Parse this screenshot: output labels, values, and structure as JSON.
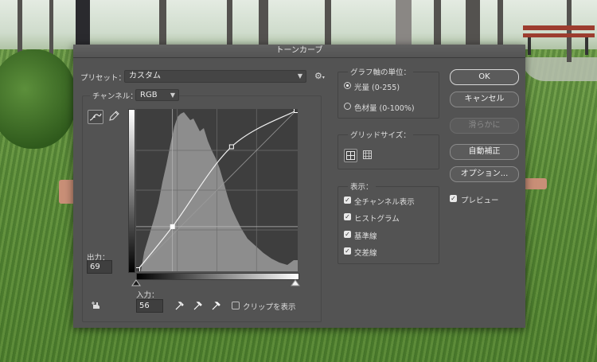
{
  "dialog": {
    "title": "トーンカーブ"
  },
  "preset": {
    "label": "プリセット：",
    "value": "カスタム",
    "menu_icon": "gear-icon"
  },
  "channel": {
    "label": "チャンネル：",
    "value": "RGB"
  },
  "tools": {
    "curve_tool_icon": "curve-point-icon",
    "pencil_tool_icon": "pencil-icon",
    "auto_adjust_icon": "hand-target-icon"
  },
  "curve": {
    "points": [
      {
        "input": 0,
        "output": 0
      },
      {
        "input": 56,
        "output": 69
      },
      {
        "input": 151,
        "output": 197
      },
      {
        "input": 255,
        "output": 255
      }
    ],
    "selected_point": 1
  },
  "output": {
    "label": "出力：",
    "value": "69"
  },
  "input": {
    "label": "入力：",
    "value": "56"
  },
  "eyedroppers": [
    "eyedropper-black-icon",
    "eyedropper-gray-icon",
    "eyedropper-white-icon"
  ],
  "show_clipping": {
    "label": "クリップを表示",
    "checked": false
  },
  "graph_units": {
    "title": "グラフ軸の単位：",
    "options": [
      {
        "label": "光量 (0-255)",
        "selected": true
      },
      {
        "label": "色材量 (0-100%)",
        "selected": false
      }
    ]
  },
  "grid_size": {
    "title": "グリッドサイズ：",
    "options": [
      "grid-4x4-icon",
      "grid-10x10-icon"
    ],
    "selected": 0
  },
  "display": {
    "title": "表示：",
    "items": [
      {
        "label": "全チャンネル表示",
        "checked": true
      },
      {
        "label": "ヒストグラム",
        "checked": true
      },
      {
        "label": "基準線",
        "checked": true
      },
      {
        "label": "交差線",
        "checked": true
      }
    ]
  },
  "buttons": {
    "ok": "OK",
    "cancel": "キャンセル",
    "smooth": "滑らかに",
    "auto": "自動補正",
    "options": "オプション..."
  },
  "preview": {
    "label": "プレビュー",
    "checked": true
  }
}
